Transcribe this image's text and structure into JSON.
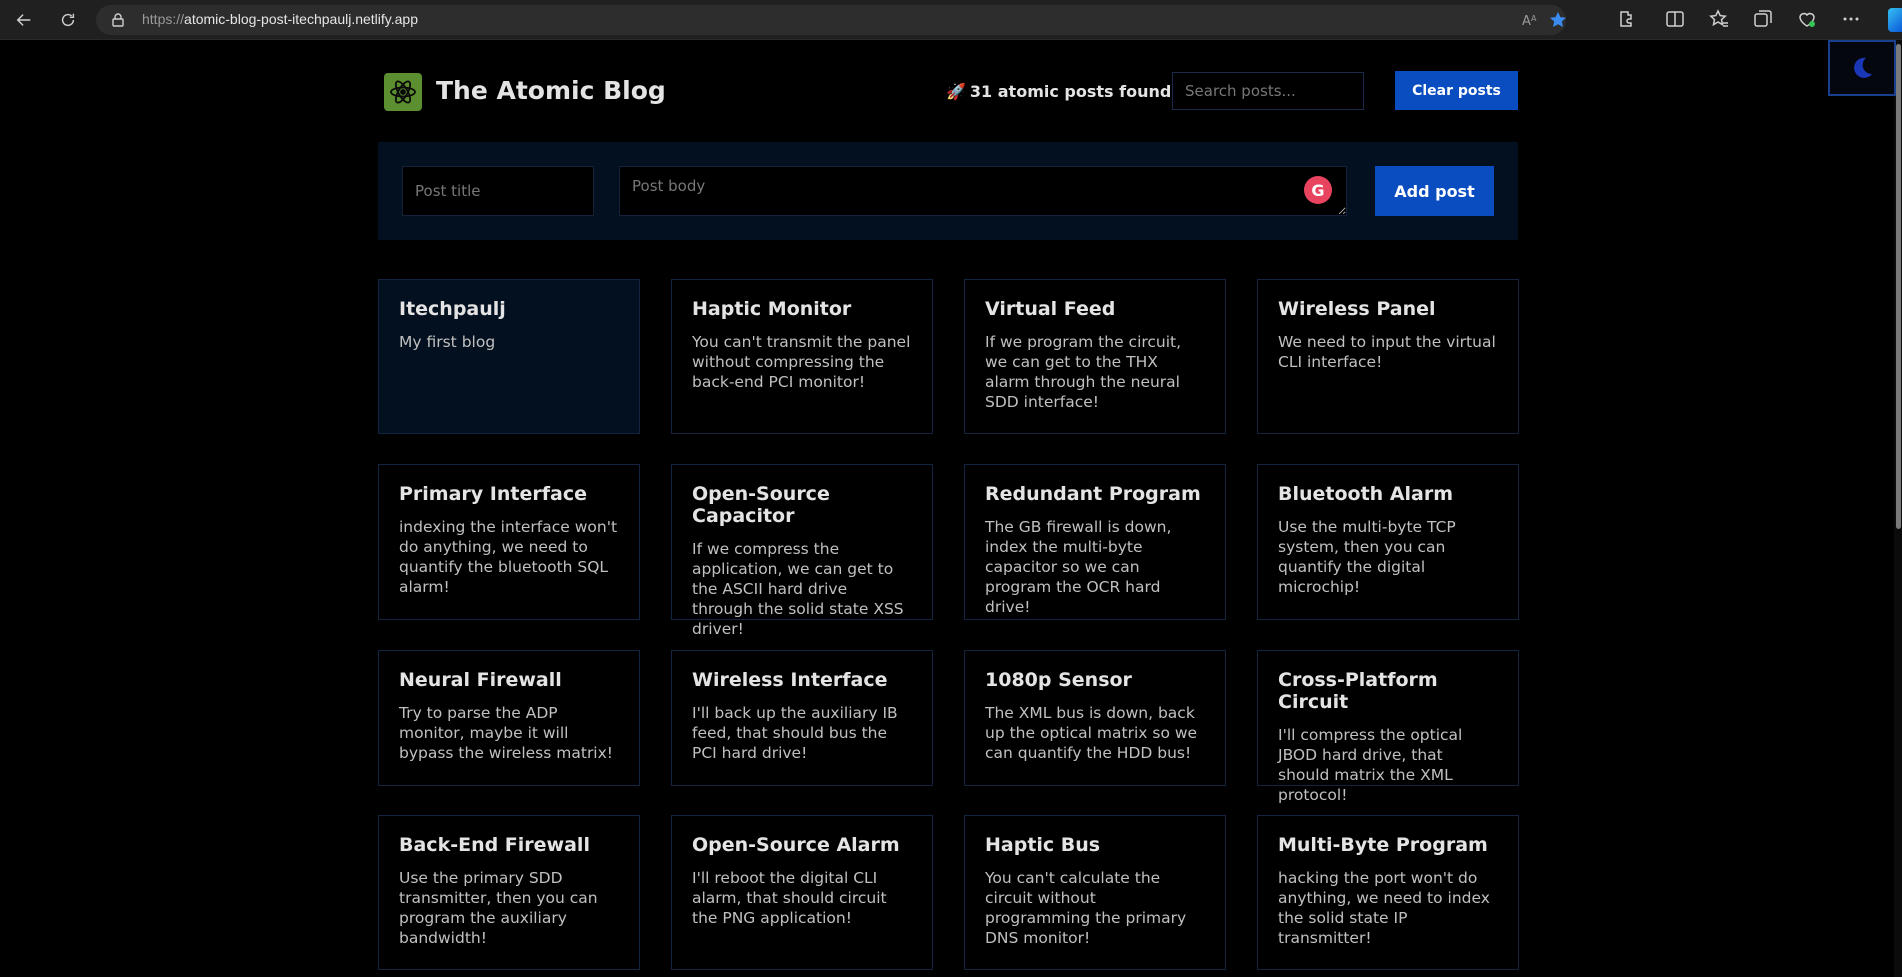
{
  "browser": {
    "url_scheme": "https://",
    "url_host": "atomic-blog-post-itechpaulj.netlify.app"
  },
  "header": {
    "title": "The Atomic Blog",
    "posts_found": "31 atomic posts found",
    "rocket": "🚀",
    "search_placeholder": "Search posts...",
    "clear_label": "Clear posts"
  },
  "form": {
    "title_placeholder": "Post title",
    "body_placeholder": "Post body",
    "add_label": "Add post",
    "grammarly_glyph": "G"
  },
  "posts": [
    {
      "title": "Itechpaulj",
      "body": "My first blog"
    },
    {
      "title": "Haptic Monitor",
      "body": "You can't transmit the panel without compressing the back-end PCI monitor!"
    },
    {
      "title": "Virtual Feed",
      "body": "If we program the circuit, we can get to the THX alarm through the neural SDD interface!"
    },
    {
      "title": "Wireless Panel",
      "body": "We need to input the virtual CLI interface!"
    },
    {
      "title": "Primary Interface",
      "body": "indexing the interface won't do anything, we need to quantify the bluetooth SQL alarm!"
    },
    {
      "title": "Open-Source Capacitor",
      "body": "If we compress the application, we can get to the ASCII hard drive through the solid state XSS driver!"
    },
    {
      "title": "Redundant Program",
      "body": "The GB firewall is down, index the multi-byte capacitor so we can program the OCR hard drive!"
    },
    {
      "title": "Bluetooth Alarm",
      "body": "Use the multi-byte TCP system, then you can quantify the digital microchip!"
    },
    {
      "title": "Neural Firewall",
      "body": "Try to parse the ADP monitor, maybe it will bypass the wireless matrix!"
    },
    {
      "title": "Wireless Interface",
      "body": "I'll back up the auxiliary IB feed, that should bus the PCI hard drive!"
    },
    {
      "title": "1080p Sensor",
      "body": "The XML bus is down, back up the optical matrix so we can quantify the HDD bus!"
    },
    {
      "title": "Cross-Platform Circuit",
      "body": "I'll compress the optical JBOD hard drive, that should matrix the XML protocol!"
    },
    {
      "title": "Back-End Firewall",
      "body": "Use the primary SDD transmitter, then you can program the auxiliary bandwidth!"
    },
    {
      "title": "Open-Source Alarm",
      "body": "I'll reboot the digital CLI alarm, that should circuit the PNG application!"
    },
    {
      "title": "Haptic Bus",
      "body": "You can't calculate the circuit without programming the primary DNS monitor!"
    },
    {
      "title": "Multi-Byte Program",
      "body": "hacking the port won't do anything, we need to index the solid state IP transmitter!"
    }
  ]
}
